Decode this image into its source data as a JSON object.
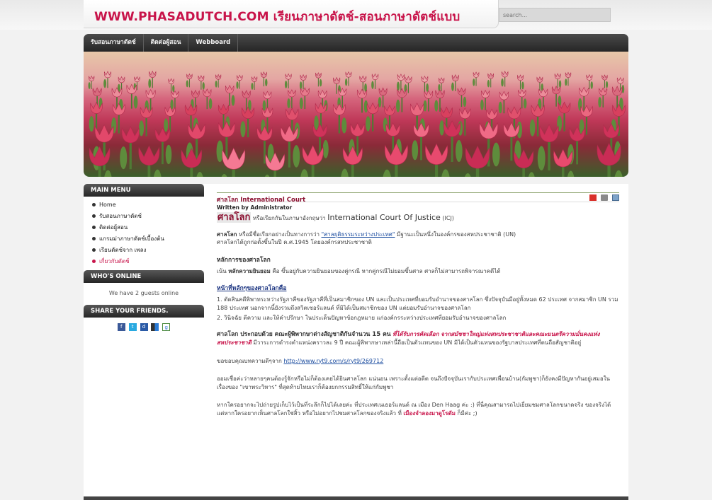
{
  "header": {
    "site_title": "WWW.PHASADUTCH.COM เรียนภาษาดัตช์-สอนภาษาดัตช์แบบ",
    "search_placeholder": "search..."
  },
  "nav": {
    "items": [
      "รับสอนภาษาดัตช์",
      "ติดต่อผู้สอน",
      "Webboard"
    ]
  },
  "sidebar": {
    "main_menu_title": "MAIN MENU",
    "menu_items": [
      "Home",
      "รับสอนภาษาดัตช์",
      "ติดต่อผู้สอน",
      "แกรมม่าภาษาดัตช์เบื้องต้น",
      "เรียนดัตช์จาก เพลง",
      "เกี่ยวกับดัตช์"
    ],
    "whos_online_title": "WHO'S ONLINE",
    "online_text": "We have 2 guests online",
    "share_title": "SHARE YOUR FRIENDS."
  },
  "article": {
    "title": "ศาลโลก International Court",
    "author": "Written by Administrator",
    "intro_big": "ศาลโลก",
    "intro_text": "หรือเรียกกันในภาษาอังกฤษว่า",
    "intro_en": "International Court Of Justice",
    "intro_icj": "(ICJ)",
    "p1_bold": "ศาลโลก",
    "p1_text1": "หรือมีชื่อเรียกอย่างเป็นทางการว่า",
    "p1_link": "\"ศาลยุติธรรมระหว่างประเทศ\"",
    "p1_text2": "มีฐานะเป็นหนึ่งในองค์กรของสหประชาชาติ (UN)",
    "p1_line2": "ศาลโลกได้ถูกก่อตั้งขึ้นในปี ค.ศ.1945 โดยองค์กรสหประชาชาติ",
    "h2": "หลักการของศาลโลก",
    "p2_text1": "เน้น",
    "p2_bold": "หลักความยินยอม",
    "p2_text2": "คือ ขึ้นอยู่กับความยินยอมของคู่กรณี หากคู่กรณีไม่ยอมขึ้นศาล ศาลก็ไม่สามารถพิจารณาคดีได้",
    "h3": "หน้าที่หลักๆของศาลโลกคือ",
    "list1": "1. ตัดสินคดีพิพาทระหว่างรัฐภาคีของรัฐภาคีที่เป็นสมาชิกของ UN และเป็นประเทศที่ยอมรับอำนาจของศาลโลก ซึ่งปัจจุบันมีอยู่ทั้งหมด 62 ประเทศ จากสมาชิก UN รวม 188 ประเทศ นอกจากนี้ยังรวมถึงสวิตเซอร์แลนด์ ที่มิได้เป็นสมาชิกของ UN แต่ยอมรับอำนาจของศาลโลก",
    "list2": "2. วินิจฉัย ตีความ และให้คำปรึกษา ในประเด็นปัญหาข้อกฎหมาย แก่องค์กรระหว่างประเทศที่ยอมรับอำนาจของศาลโลก",
    "p4_bold": "ศาลโลก ประกอบด้วย คณะผู้พิพากษาต่างสัญชาติกันจำนวน 15 คน",
    "p4_italic": "ที่ได้รับการคัดเลือก จากสมัชชาใหญ่แห่งสหประชาชาติและคณะมนตรีความมั่นคงแห่งสหประชาชาติ",
    "p4_text": "มีวาระการดำรงตำแหน่งคราวละ 9 ปี คณะผู้พิพากษาเหล่านี้ถือเป็นตัวแทนของ UN มิได้เป็นตัวแทนของรัฐบาลประเทศที่ตนถือสัญชาติอยู่",
    "thanks_text": "ขอขอบคุณบทความดีๆจาก",
    "thanks_link": "http://www.ryt9.com/s/ryt9/269712",
    "p6": "ออมเชื่อค่ะว่าหลายๆคนต้องรู้จักหรือไม่ก็ต้องเคยได้ยินศาลโลก แน่นอน เพราะตั้งแต่อดีต จนถึงปัจจุบันเรากับประเทศเพื่อนบ้าน(กัมพูชา)ก็ยังคงมีปัญหากันอยู่เสมอในเรื่องของ \"เขาพระวิหาร\" ที่สุดท้ายไทยเราก็ต้องยกกรรมสิทธิ์ให้แก่กัมพูชา",
    "p7_text1": "หากใครอยากจะไปถ่ายรูปเก็บไว้เป็นที่ระลึกก็ไปได้เลยค่ะ ที่ประเทศเนเธอร์แลนด์ ณ เมือง Den Haag ค่ะ :) ที่นี่คุณสามารถไปเยี่ยมชมศาลโลกขนาดจริง ของจริงได้ แต่หากใครอยากเห็นศาลโลกใช่สิ้ว หรือไม่อยากไปชมศาลโลกของจริงแล้ว ที่",
    "p7_pink": "เมืองจำลองมาดูโรดัม",
    "p7_text2": "ก็มีค่ะ ;)"
  },
  "colors": {
    "brand": "#c8144a",
    "nav_bg": "#2d2d2d",
    "link": "#1d4ea0"
  }
}
